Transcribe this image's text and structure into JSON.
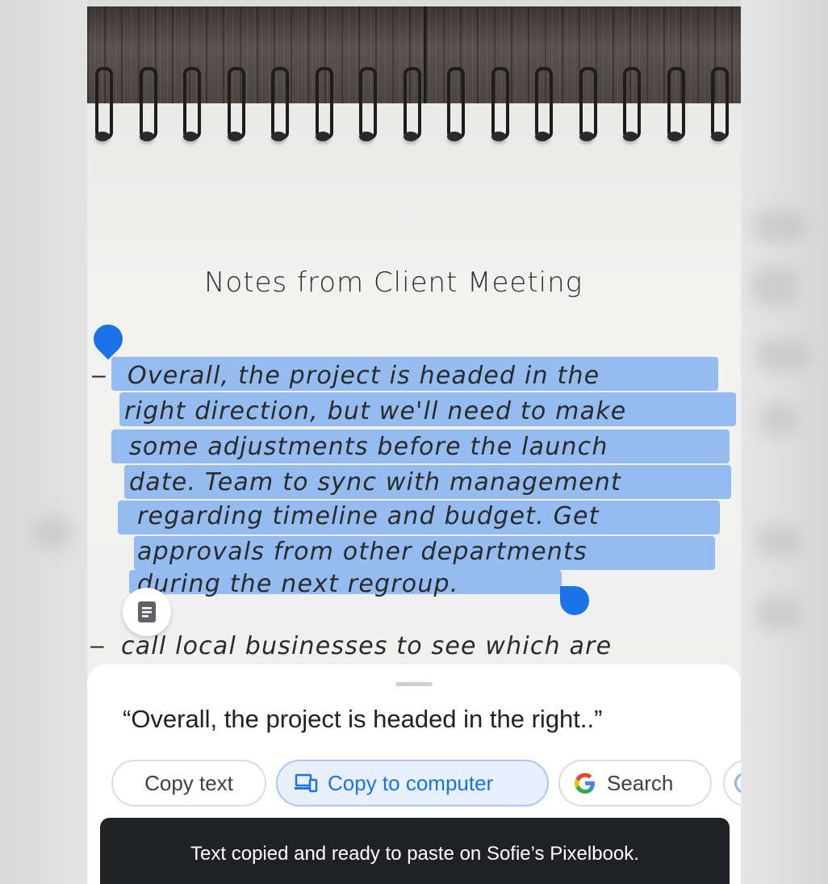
{
  "notebook": {
    "title": "Notes from Client Meeting",
    "selected_lines": [
      "Overall, the project is headed in the",
      "right direction, but we'll need to make",
      "some adjustments before the launch",
      "date. Team to sync with management",
      "regarding timeline and budget. Get",
      "approvals from other departments",
      "during the next regroup."
    ],
    "next_line": "call local businesses to see which are"
  },
  "sheet": {
    "quote": "“Overall, the project is headed in the right..”",
    "chips": {
      "copy_text": "Copy text",
      "copy_to_computer": "Copy to computer",
      "search": "Search"
    },
    "toast": "Text copied and ready to paste on Sofie’s Pixelbook."
  },
  "icons": {
    "fab": "document-icon",
    "copy_to_computer": "devices-icon",
    "search": "google-g-icon"
  },
  "colors": {
    "accent": "#1a73e8",
    "highlight": "#70a8f0",
    "toast_bg": "#202124"
  }
}
